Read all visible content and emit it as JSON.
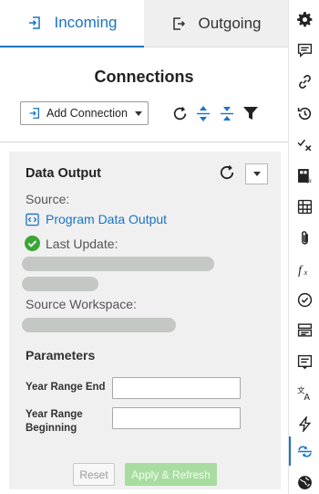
{
  "tabs": {
    "incoming": "Incoming",
    "outgoing": "Outgoing"
  },
  "title": "Connections",
  "toolbar": {
    "add_label": "Add Connection"
  },
  "card": {
    "title": "Data Output",
    "source_label": "Source:",
    "source_link": "Program Data Output",
    "last_update_label": "Last Update:",
    "workspace_label": "Source Workspace:",
    "params_title": "Parameters",
    "fields": [
      {
        "label": "Year Range End",
        "value": ""
      },
      {
        "label": "Year Range Beginning",
        "value": ""
      }
    ],
    "reset": "Reset",
    "apply": "Apply & Refresh"
  },
  "colors": {
    "accent": "#1a73c8",
    "success": "#3aa635",
    "apply_disabled": "#a8dca0"
  },
  "rail_icons": [
    "gear-icon",
    "comment-icon",
    "link-icon",
    "history-icon",
    "check-x-icon",
    "formula-sheet-icon",
    "grid-icon",
    "paperclip-icon",
    "function-icon",
    "check-circle-icon",
    "cards-icon",
    "summary-icon",
    "translate-icon",
    "lightning-icon",
    "connections-icon",
    "globe-icon"
  ]
}
